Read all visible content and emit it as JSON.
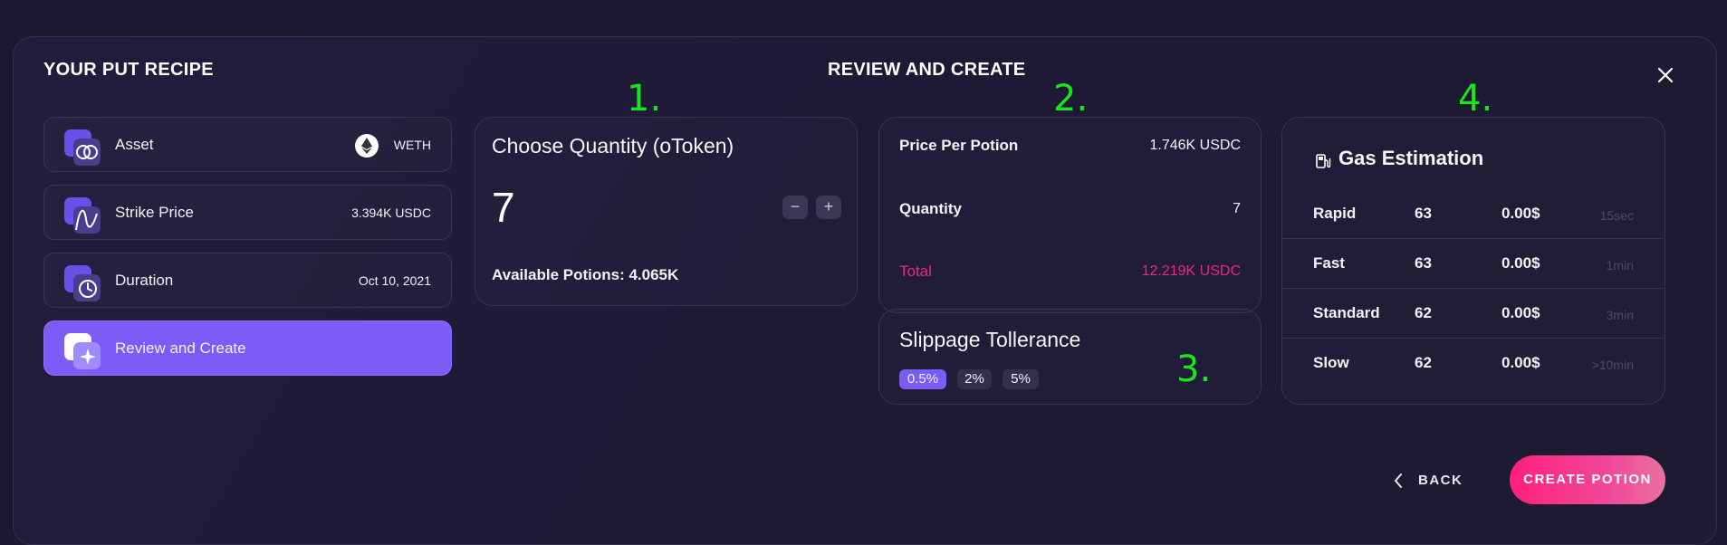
{
  "recipe": {
    "title": "YOUR PUT RECIPE",
    "steps": [
      {
        "label": "Asset",
        "value": "WETH",
        "icon": "asset-icon",
        "token_icon": "ethereum-icon"
      },
      {
        "label": "Strike Price",
        "value": "3.394K USDC",
        "icon": "strike-price-icon"
      },
      {
        "label": "Duration",
        "value": "Oct 10, 2021",
        "icon": "clock-icon"
      },
      {
        "label": "Review and Create",
        "value": "",
        "icon": "sparkle-icon",
        "active": true
      }
    ]
  },
  "review": {
    "title": "REVIEW AND CREATE",
    "annotations": [
      "1.",
      "2.",
      "3.",
      "4."
    ]
  },
  "quantity": {
    "title": "Choose Quantity (oToken)",
    "value": "7",
    "decrement": "−",
    "increment": "+",
    "available": "Available Potions: 4.065K"
  },
  "summary": {
    "price_label": "Price Per Potion",
    "price_value": "1.746K USDC",
    "quantity_label": "Quantity",
    "quantity_value": "7",
    "total_label": "Total",
    "total_value": "12.219K USDC"
  },
  "slippage": {
    "title": "Slippage Tollerance",
    "options": [
      "0.5%",
      "2%",
      "5%"
    ],
    "selected": "0.5%"
  },
  "gas": {
    "title": "Gas Estimation",
    "rows": [
      {
        "name": "Rapid",
        "value": "63",
        "cost": "0.00$",
        "time": "15sec"
      },
      {
        "name": "Fast",
        "value": "63",
        "cost": "0.00$",
        "time": "1min"
      },
      {
        "name": "Standard",
        "value": "62",
        "cost": "0.00$",
        "time": "3min"
      },
      {
        "name": "Slow",
        "value": "62",
        "cost": "0.00$",
        "time": ">10min"
      }
    ]
  },
  "actions": {
    "back": "BACK",
    "create": "CREATE POTION"
  },
  "colors": {
    "accent": "#7a5cf6",
    "total": "#e8277f",
    "create_start": "#ff1f7c",
    "create_end": "#e8719f",
    "annotation": "#19e619"
  }
}
